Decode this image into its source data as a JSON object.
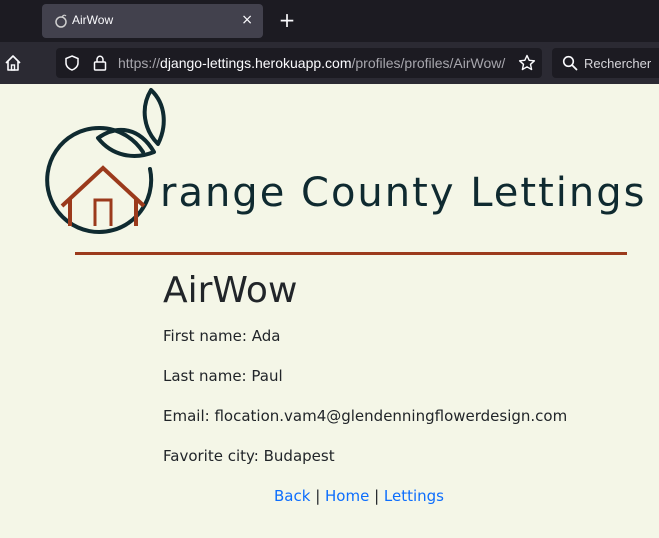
{
  "browser": {
    "tab_title": "AirWow",
    "tab_close": "×",
    "new_tab": "+",
    "url_prefix": "https://",
    "url_host": "django-lettings.herokuapp.com",
    "url_path": "/profiles/profiles/AirWow/",
    "search_placeholder": "Rechercher"
  },
  "site": {
    "logo_text": "range County Lettings",
    "brand_color": "#9b3a1c",
    "logo_color": "#0f2a30"
  },
  "profile": {
    "username": "AirWow",
    "first_name_label": "First name: ",
    "first_name": "Ada",
    "last_name_label": "Last name: ",
    "last_name": "Paul",
    "email_label": "Email: ",
    "email": "flocation.vam4@glendenningflowerdesign.com",
    "favorite_city_label": "Favorite city: ",
    "favorite_city": "Budapest"
  },
  "links": {
    "back": "Back",
    "home": "Home",
    "lettings": "Lettings",
    "separator": " | "
  },
  "icons": [
    "orange-favicon-icon",
    "close-icon",
    "plus-icon",
    "home-icon",
    "shield-icon",
    "lock-icon",
    "star-icon",
    "search-icon"
  ]
}
